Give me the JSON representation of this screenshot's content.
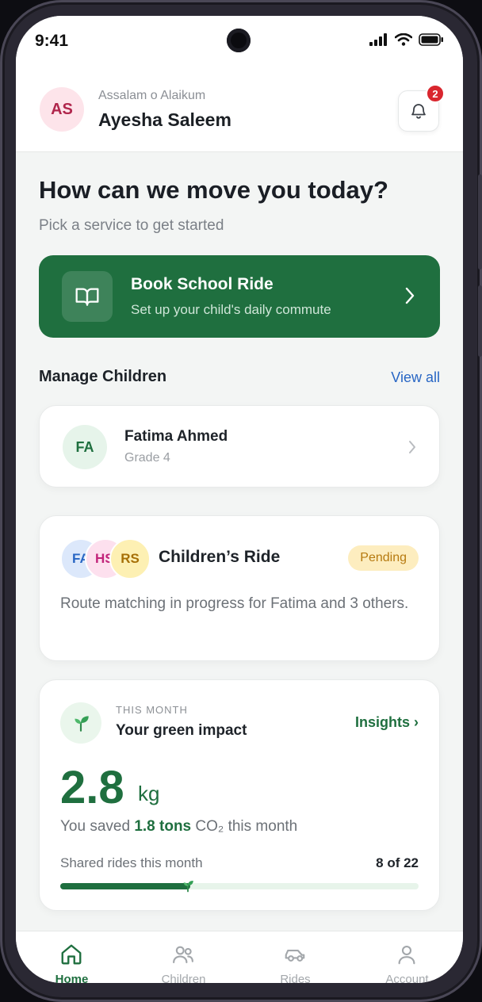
{
  "status_bar": {
    "time": "9:41"
  },
  "header": {
    "avatar_initials": "AS",
    "greeting": "Assalam o Alaikum",
    "user_name": "Ayesha Saleem",
    "notification_count": "2"
  },
  "hero": {
    "title": "How can we move you today?",
    "subtitle": "Pick a service to get started"
  },
  "book_ride": {
    "title": "Book School Ride",
    "subtitle": "Set up your child's daily commute"
  },
  "manage_children": {
    "section_title": "Manage Children",
    "view_all_label": "View all",
    "children": [
      {
        "initials": "FA",
        "name": "Fatima Ahmed",
        "grade": "Grade 4"
      }
    ]
  },
  "children_ride": {
    "avatars": [
      "FA",
      "HS",
      "RS"
    ],
    "title": "Children’s Ride",
    "status": "Pending",
    "description": "Route matching in progress for Fatima and 3 others."
  },
  "green_impact": {
    "eyebrow": "THIS MONTH",
    "title": "Your green impact",
    "insights_label": "Insights ›",
    "value": "2.8",
    "unit": "kg",
    "saved_prefix": "You saved ",
    "saved_amount": "1.8 tons",
    "saved_suffix": " CO₂ this month",
    "shared_label": "Shared rides this month",
    "shared_count": "8 of 22",
    "shared_progress_fraction": 0.3636
  },
  "tabs": [
    {
      "label": "Home",
      "icon": "home-icon",
      "active": true
    },
    {
      "label": "Children",
      "icon": "children-icon",
      "active": false
    },
    {
      "label": "Rides",
      "icon": "car-icon",
      "active": false
    },
    {
      "label": "Account",
      "icon": "person-icon",
      "active": false
    }
  ],
  "colors": {
    "brand_green": "#1f6f3f",
    "link_blue": "#2866c4",
    "badge_red": "#d9262e",
    "pending_bg": "#fdedbf"
  }
}
